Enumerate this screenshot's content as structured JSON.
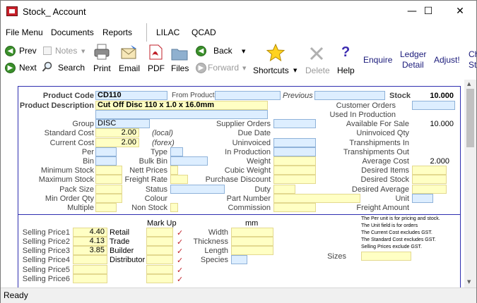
{
  "window": {
    "title": "Stock_ Account",
    "minimize": "—",
    "maximize": "☐",
    "close": "✕"
  },
  "menu": [
    "File Menu",
    "Documents",
    "Reports",
    "LILAC",
    "QCAD"
  ],
  "toolbar": {
    "prev": "Prev",
    "notes": "Notes",
    "print": "Print",
    "email": "Email",
    "pdf": "PDF",
    "files": "Files",
    "back": "Back",
    "forward": "Forward",
    "shortcuts": "Shortcuts",
    "delete": "Delete",
    "help": "Help",
    "enquire": "Enquire",
    "ledger_detail_1": "Ledger",
    "ledger_detail_2": "Detail",
    "adjust": "Adjust!",
    "cut_1": "Ch",
    "cut_2": "St",
    "next": "Next",
    "search": "Search",
    "help_glyph": "?"
  },
  "header": {
    "product_code_label": "Product Code",
    "product_code": "CD110",
    "from_product_label": "From Product",
    "previous_label": "Previous",
    "stock_label": "Stock",
    "stock": "10.000",
    "description_label": "Product Description",
    "description": "Cut Off Disc 110 x 1.0 x 16.0mm",
    "customer_orders_label": "Customer Orders",
    "used_in_production_label": "Used In Production"
  },
  "details": {
    "group_label": "Group",
    "group": "DISC",
    "standard_cost_label": "Standard Cost",
    "standard_cost": "2.00",
    "local_label": "(local)",
    "current_cost_label": "Current Cost",
    "current_cost": "2.00",
    "forex_label": "(forex)",
    "per_label": "Per",
    "bin_label": "Bin",
    "min_stock_label": "Minimum Stock",
    "max_stock_label": "Maximum Stock",
    "pack_size_label": "Pack Size",
    "min_order_label": "Min Order Qty",
    "multiple_label": "Multiple",
    "type_label": "Type",
    "bulk_bin_label": "Bulk Bin",
    "nett_prices_label": "Nett Prices",
    "freight_rate_label": "Freight Rate",
    "status_label": "Status",
    "colour_label": "Colour",
    "non_stock_label": "Non Stock",
    "supplier_orders_label": "Supplier Orders",
    "due_date_label": "Due Date",
    "uninvoiced_label": "Uninvoiced",
    "in_production_label": "In Production",
    "weight_label": "Weight",
    "cubic_weight_label": "Cubic Weight",
    "purchase_discount_label": "Purchase Discount",
    "duty_label": "Duty",
    "part_number_label": "Part Number",
    "commission_label": "Commission",
    "available_label": "Available For Sale",
    "available": "10.000",
    "uninvoiced_qty_label": "Uninvoiced Qty",
    "transhipments_in_label": "Transhipments In",
    "transhipments_out_label": "Transhipments Out",
    "average_cost_label": "Average Cost",
    "average_cost": "2.000",
    "desired_items_label": "Desired Items",
    "desired_stock_label": "Desired Stock",
    "desired_average_label": "Desired Average",
    "unit_label": "Unit",
    "freight_amount_label": "Freight Amount"
  },
  "pricing": {
    "mark_up_label": "Mark Up",
    "mm_label": "mm",
    "prices": [
      {
        "label": "Selling Price1",
        "value": "4.40",
        "tier": "Retail"
      },
      {
        "label": "Selling Price2",
        "value": "4.13",
        "tier": "Trade"
      },
      {
        "label": "Selling Price3",
        "value": "3.85",
        "tier": "Builder"
      },
      {
        "label": "Selling Price4",
        "value": "",
        "tier": "Distributor"
      },
      {
        "label": "Selling Price5",
        "value": "",
        "tier": ""
      },
      {
        "label": "Selling Price6",
        "value": "",
        "tier": ""
      }
    ],
    "check": "✓",
    "width_label": "Width",
    "thickness_label": "Thickness",
    "length_label": "Length",
    "species_label": "Species",
    "sizes_label": "Sizes",
    "notes": [
      "The Per unit is for pricing and stock.",
      "The Unit field is for orders",
      "The Current Cost excludes GST.",
      "The Standard Cost excludes GST.",
      "Selling Prices exclude GST."
    ]
  },
  "status": "Ready"
}
